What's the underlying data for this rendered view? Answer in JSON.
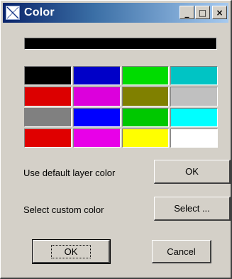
{
  "window": {
    "title": "Color",
    "minimize_glyph": "_",
    "maximize_glyph": "□",
    "close_glyph": "×"
  },
  "current_color": "#000000",
  "swatches": [
    "#000000",
    "#0000c8",
    "#00dc00",
    "#00c4c4",
    "#dc0000",
    "#dc00dc",
    "#808000",
    "#c0c0c0",
    "#808080",
    "#0000ff",
    "#00c800",
    "#00ffff",
    "#e00000",
    "#e800e8",
    "#ffff00",
    "#ffffff"
  ],
  "rows": {
    "default_label": "Use default layer color",
    "default_button": "OK",
    "custom_label": "Select custom color",
    "custom_button": "Select ..."
  },
  "footer": {
    "ok_label": "OK",
    "cancel_label": "Cancel"
  }
}
